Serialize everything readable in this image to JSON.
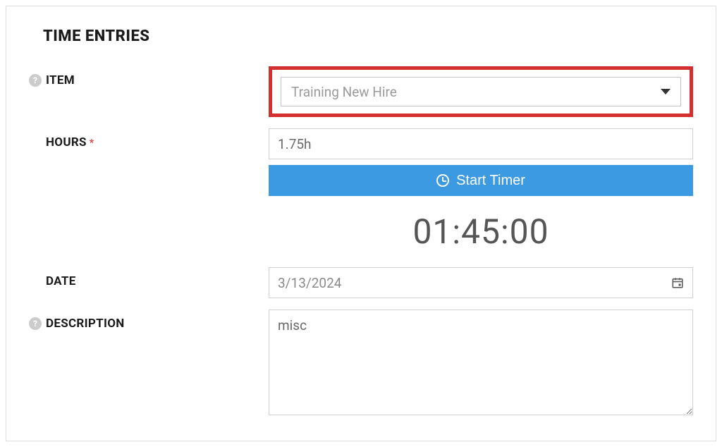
{
  "section": {
    "title": "TIME ENTRIES"
  },
  "labels": {
    "item": "ITEM",
    "hours": "HOURS",
    "date": "DATE",
    "description": "DESCRIPTION"
  },
  "values": {
    "item_selected": "Training New Hire",
    "hours": "1.75h",
    "timer_display": "01:45:00",
    "date": "3/13/2024",
    "description": "misc"
  },
  "buttons": {
    "start_timer": "Start Timer"
  },
  "help_glyph": "?"
}
